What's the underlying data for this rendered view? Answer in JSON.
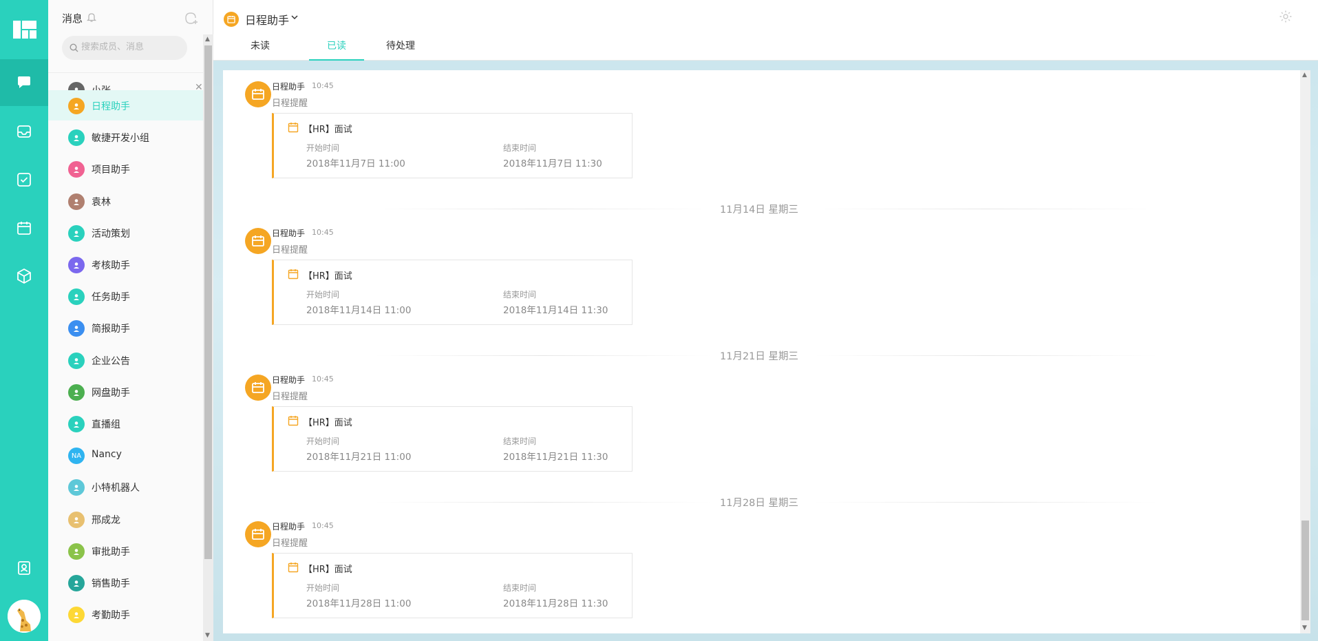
{
  "colors": {
    "accent": "#2ad1bd",
    "orange": "#f5a623"
  },
  "rail": {
    "items": [
      {
        "icon": "chat-icon",
        "active": true
      },
      {
        "icon": "inbox-icon"
      },
      {
        "icon": "task-check-icon"
      },
      {
        "icon": "calendar-icon"
      },
      {
        "icon": "cube-icon"
      },
      {
        "icon": "contacts-icon"
      }
    ]
  },
  "list": {
    "title": "消息",
    "search_placeholder": "搜索成员、消息",
    "conversations": [
      {
        "name": "小张",
        "avatar": "photo",
        "color": "#666"
      },
      {
        "name": "日程助手",
        "avatar": "calendar",
        "color": "#f5a623",
        "active": true
      },
      {
        "name": "敏捷开发小组",
        "avatar": "group",
        "color": "#2ad1bd"
      },
      {
        "name": "项目助手",
        "avatar": "project",
        "color": "#f06292"
      },
      {
        "name": "袁林",
        "avatar": "photo",
        "color": "#b08070"
      },
      {
        "name": "活动策划",
        "avatar": "group",
        "color": "#2ad1bd"
      },
      {
        "name": "考核助手",
        "avatar": "review",
        "color": "#7b68ee"
      },
      {
        "name": "任务助手",
        "avatar": "task",
        "color": "#2ad1bd"
      },
      {
        "name": "简报助手",
        "avatar": "report",
        "color": "#3b8ff0"
      },
      {
        "name": "企业公告",
        "avatar": "notice",
        "color": "#2ad1bd"
      },
      {
        "name": "网盘助手",
        "avatar": "folder",
        "color": "#4caf50"
      },
      {
        "name": "直播组",
        "avatar": "group",
        "color": "#2ad1bd"
      },
      {
        "name": "Nancy",
        "avatar": "NA",
        "color": "#2fb4f0"
      },
      {
        "name": "小特机器人",
        "avatar": "robot",
        "color": "#5ec8d8"
      },
      {
        "name": "邢成龙",
        "avatar": "giraffe",
        "color": "#e8c070"
      },
      {
        "name": "审批助手",
        "avatar": "approve",
        "color": "#8bc34a"
      },
      {
        "name": "销售助手",
        "avatar": "sales",
        "color": "#26a69a"
      },
      {
        "name": "考勤助手",
        "avatar": "attendance",
        "color": "#fdd835"
      }
    ]
  },
  "header": {
    "title": "日程助手",
    "tabs": [
      {
        "label": "未读"
      },
      {
        "label": "已读",
        "active": true
      },
      {
        "label": "待处理"
      }
    ]
  },
  "messages": [
    {
      "sender": "日程助手",
      "time": "10:45",
      "subtitle": "日程提醒",
      "event": "【HR】面试",
      "start_label": "开始时间",
      "start": "2018年11月7日 11:00",
      "end_label": "结束时间",
      "end": "2018年11月7日 11:30"
    },
    {
      "divider": "11月14日 星期三"
    },
    {
      "sender": "日程助手",
      "time": "10:45",
      "subtitle": "日程提醒",
      "event": "【HR】面试",
      "start_label": "开始时间",
      "start": "2018年11月14日 11:00",
      "end_label": "结束时间",
      "end": "2018年11月14日 11:30"
    },
    {
      "divider": "11月21日 星期三"
    },
    {
      "sender": "日程助手",
      "time": "10:45",
      "subtitle": "日程提醒",
      "event": "【HR】面试",
      "start_label": "开始时间",
      "start": "2018年11月21日 11:00",
      "end_label": "结束时间",
      "end": "2018年11月21日 11:30"
    },
    {
      "divider": "11月28日 星期三"
    },
    {
      "sender": "日程助手",
      "time": "10:45",
      "subtitle": "日程提醒",
      "event": "【HR】面试",
      "start_label": "开始时间",
      "start": "2018年11月28日 11:00",
      "end_label": "结束时间",
      "end": "2018年11月28日 11:30"
    }
  ]
}
